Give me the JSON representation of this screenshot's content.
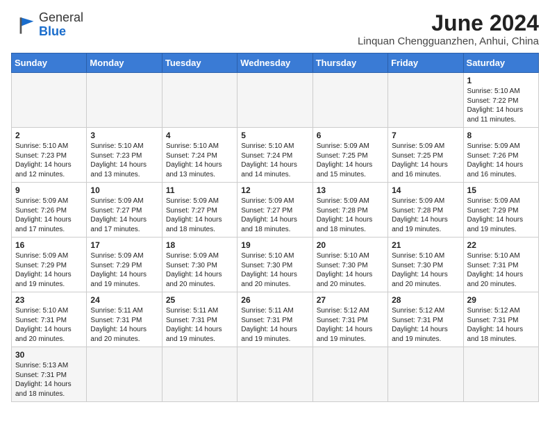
{
  "header": {
    "logo_general": "General",
    "logo_blue": "Blue",
    "month_title": "June 2024",
    "location": "Linquan Chengguanzhen, Anhui, China"
  },
  "weekdays": [
    "Sunday",
    "Monday",
    "Tuesday",
    "Wednesday",
    "Thursday",
    "Friday",
    "Saturday"
  ],
  "weeks": [
    [
      {
        "day": "",
        "info": "",
        "empty": true
      },
      {
        "day": "",
        "info": "",
        "empty": true
      },
      {
        "day": "",
        "info": "",
        "empty": true
      },
      {
        "day": "",
        "info": "",
        "empty": true
      },
      {
        "day": "",
        "info": "",
        "empty": true
      },
      {
        "day": "",
        "info": "",
        "empty": true
      },
      {
        "day": "1",
        "info": "Sunrise: 5:10 AM\nSunset: 7:22 PM\nDaylight: 14 hours and 11 minutes."
      }
    ],
    [
      {
        "day": "2",
        "info": "Sunrise: 5:10 AM\nSunset: 7:23 PM\nDaylight: 14 hours and 12 minutes."
      },
      {
        "day": "3",
        "info": "Sunrise: 5:10 AM\nSunset: 7:23 PM\nDaylight: 14 hours and 13 minutes."
      },
      {
        "day": "4",
        "info": "Sunrise: 5:10 AM\nSunset: 7:24 PM\nDaylight: 14 hours and 13 minutes."
      },
      {
        "day": "5",
        "info": "Sunrise: 5:10 AM\nSunset: 7:24 PM\nDaylight: 14 hours and 14 minutes."
      },
      {
        "day": "6",
        "info": "Sunrise: 5:09 AM\nSunset: 7:25 PM\nDaylight: 14 hours and 15 minutes."
      },
      {
        "day": "7",
        "info": "Sunrise: 5:09 AM\nSunset: 7:25 PM\nDaylight: 14 hours and 16 minutes."
      },
      {
        "day": "8",
        "info": "Sunrise: 5:09 AM\nSunset: 7:26 PM\nDaylight: 14 hours and 16 minutes."
      }
    ],
    [
      {
        "day": "9",
        "info": "Sunrise: 5:09 AM\nSunset: 7:26 PM\nDaylight: 14 hours and 17 minutes."
      },
      {
        "day": "10",
        "info": "Sunrise: 5:09 AM\nSunset: 7:27 PM\nDaylight: 14 hours and 17 minutes."
      },
      {
        "day": "11",
        "info": "Sunrise: 5:09 AM\nSunset: 7:27 PM\nDaylight: 14 hours and 18 minutes."
      },
      {
        "day": "12",
        "info": "Sunrise: 5:09 AM\nSunset: 7:27 PM\nDaylight: 14 hours and 18 minutes."
      },
      {
        "day": "13",
        "info": "Sunrise: 5:09 AM\nSunset: 7:28 PM\nDaylight: 14 hours and 18 minutes."
      },
      {
        "day": "14",
        "info": "Sunrise: 5:09 AM\nSunset: 7:28 PM\nDaylight: 14 hours and 19 minutes."
      },
      {
        "day": "15",
        "info": "Sunrise: 5:09 AM\nSunset: 7:29 PM\nDaylight: 14 hours and 19 minutes."
      }
    ],
    [
      {
        "day": "16",
        "info": "Sunrise: 5:09 AM\nSunset: 7:29 PM\nDaylight: 14 hours and 19 minutes."
      },
      {
        "day": "17",
        "info": "Sunrise: 5:09 AM\nSunset: 7:29 PM\nDaylight: 14 hours and 19 minutes."
      },
      {
        "day": "18",
        "info": "Sunrise: 5:09 AM\nSunset: 7:30 PM\nDaylight: 14 hours and 20 minutes."
      },
      {
        "day": "19",
        "info": "Sunrise: 5:10 AM\nSunset: 7:30 PM\nDaylight: 14 hours and 20 minutes."
      },
      {
        "day": "20",
        "info": "Sunrise: 5:10 AM\nSunset: 7:30 PM\nDaylight: 14 hours and 20 minutes."
      },
      {
        "day": "21",
        "info": "Sunrise: 5:10 AM\nSunset: 7:30 PM\nDaylight: 14 hours and 20 minutes."
      },
      {
        "day": "22",
        "info": "Sunrise: 5:10 AM\nSunset: 7:31 PM\nDaylight: 14 hours and 20 minutes."
      }
    ],
    [
      {
        "day": "23",
        "info": "Sunrise: 5:10 AM\nSunset: 7:31 PM\nDaylight: 14 hours and 20 minutes."
      },
      {
        "day": "24",
        "info": "Sunrise: 5:11 AM\nSunset: 7:31 PM\nDaylight: 14 hours and 20 minutes."
      },
      {
        "day": "25",
        "info": "Sunrise: 5:11 AM\nSunset: 7:31 PM\nDaylight: 14 hours and 19 minutes."
      },
      {
        "day": "26",
        "info": "Sunrise: 5:11 AM\nSunset: 7:31 PM\nDaylight: 14 hours and 19 minutes."
      },
      {
        "day": "27",
        "info": "Sunrise: 5:12 AM\nSunset: 7:31 PM\nDaylight: 14 hours and 19 minutes."
      },
      {
        "day": "28",
        "info": "Sunrise: 5:12 AM\nSunset: 7:31 PM\nDaylight: 14 hours and 19 minutes."
      },
      {
        "day": "29",
        "info": "Sunrise: 5:12 AM\nSunset: 7:31 PM\nDaylight: 14 hours and 18 minutes."
      }
    ],
    [
      {
        "day": "30",
        "info": "Sunrise: 5:13 AM\nSunset: 7:31 PM\nDaylight: 14 hours and 18 minutes.",
        "last_row": true
      },
      {
        "day": "",
        "info": "",
        "empty": true
      },
      {
        "day": "",
        "info": "",
        "empty": true
      },
      {
        "day": "",
        "info": "",
        "empty": true
      },
      {
        "day": "",
        "info": "",
        "empty": true
      },
      {
        "day": "",
        "info": "",
        "empty": true
      },
      {
        "day": "",
        "info": "",
        "empty": true
      }
    ]
  ]
}
